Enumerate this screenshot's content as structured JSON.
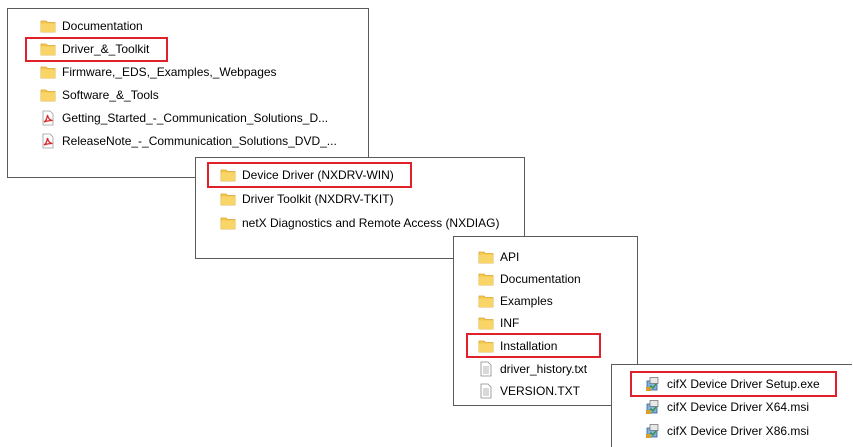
{
  "panel1": {
    "items": [
      {
        "label": "Documentation",
        "icon": "folder-icon"
      },
      {
        "label": "Driver_&_Toolkit",
        "icon": "folder-icon"
      },
      {
        "label": "Firmware,_EDS,_Examples,_Webpages",
        "icon": "folder-icon"
      },
      {
        "label": "Software_&_Tools",
        "icon": "folder-icon"
      },
      {
        "label": "Getting_Started_-_Communication_Solutions_D...",
        "icon": "pdf-icon"
      },
      {
        "label": "ReleaseNote_-_Communication_Solutions_DVD_...",
        "icon": "pdf-icon"
      }
    ]
  },
  "panel2": {
    "items": [
      {
        "label": "Device Driver (NXDRV-WIN)",
        "icon": "folder-icon"
      },
      {
        "label": "Driver Toolkit (NXDRV-TKIT)",
        "icon": "folder-icon"
      },
      {
        "label": "netX Diagnostics and Remote Access (NXDIAG)",
        "icon": "folder-icon"
      }
    ]
  },
  "panel3": {
    "items": [
      {
        "label": "API",
        "icon": "folder-icon"
      },
      {
        "label": "Documentation",
        "icon": "folder-icon"
      },
      {
        "label": "Examples",
        "icon": "folder-icon"
      },
      {
        "label": "INF",
        "icon": "folder-icon"
      },
      {
        "label": "Installation",
        "icon": "folder-icon"
      },
      {
        "label": "driver_history.txt",
        "icon": "text-file-icon"
      },
      {
        "label": "VERSION.TXT",
        "icon": "text-file-icon"
      }
    ]
  },
  "panel4": {
    "items": [
      {
        "label": "cifX Device Driver Setup.exe",
        "icon": "installer-icon"
      },
      {
        "label": "cifX Device Driver X64.msi",
        "icon": "installer-icon"
      },
      {
        "label": "cifX Device Driver X86.msi",
        "icon": "installer-icon"
      }
    ]
  },
  "colors": {
    "highlight": "#e0202a",
    "folder": "#f4c84a",
    "pdf": "#d92a2a"
  }
}
